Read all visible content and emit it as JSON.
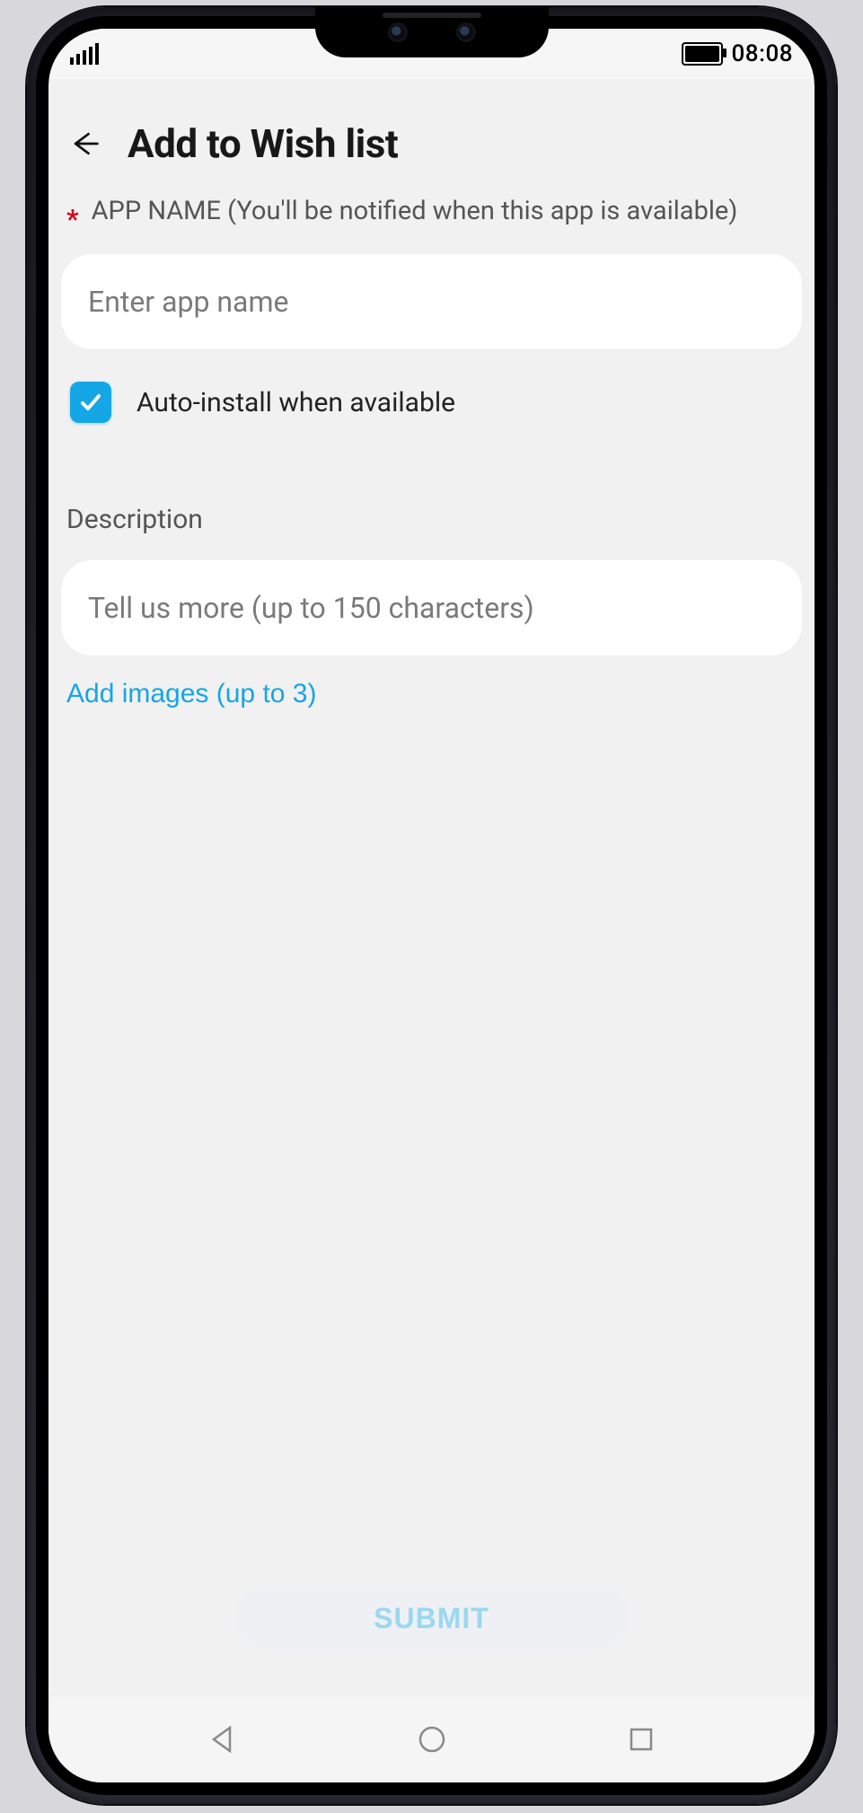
{
  "status": {
    "time": "08:08"
  },
  "header": {
    "title": "Add to Wish list"
  },
  "form": {
    "app_name_label": "APP NAME (You'll be notified when this app is available)",
    "app_name_placeholder": "Enter app name",
    "auto_install_label": "Auto-install when available",
    "auto_install_checked": true,
    "description_label": "Description",
    "description_placeholder": "Tell us more (up to 150 characters)",
    "add_images_label": "Add images (up to 3)",
    "submit_label": "SUBMIT"
  },
  "colors": {
    "accent": "#15a6e6"
  }
}
